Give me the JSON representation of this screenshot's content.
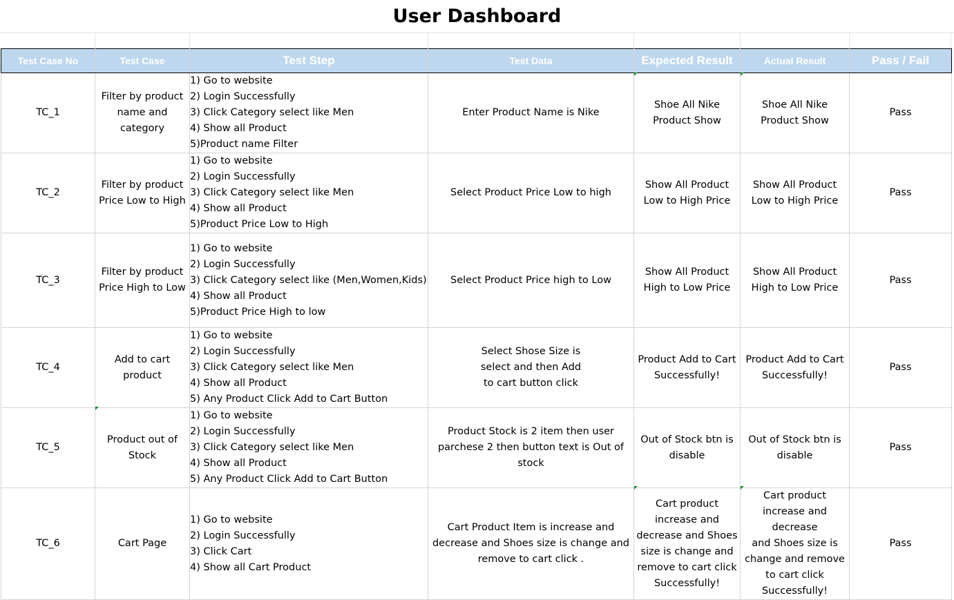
{
  "title": "User Dashboard",
  "columns": [
    "Test Case No",
    "Test Case",
    "Test Step",
    "Test Data",
    "Expected Result",
    "Actual Result",
    "Pass / Fail"
  ],
  "rows": [
    {
      "no": "TC_1",
      "case": "Filter by product\nname and\ncategory",
      "steps": [
        "1) Go to website",
        "2) Login Successfully",
        "3) Click Category select like Men",
        "4) Show all Product",
        "5)Product name Filter"
      ],
      "data": "Enter Product Name is Nike",
      "expected": "Shoe All Nike\nProduct Show",
      "actual": "Shoe All Nike\nProduct Show",
      "result": "Pass"
    },
    {
      "no": "TC_2",
      "case": "Filter by product\nPrice Low to High",
      "steps": [
        "1) Go to website",
        "2) Login Successfully",
        "3) Click Category select like Men",
        "4) Show all Product",
        "5)Product Price Low to High"
      ],
      "data": "Select Product Price Low to high",
      "expected": "Show All Product\nLow to High Price",
      "actual": "Show All Product\nLow to High Price",
      "result": "Pass"
    },
    {
      "no": "TC_3",
      "case": "Filter by product\nPrice High to Low",
      "steps": [
        "1) Go to website",
        "2) Login Successfully",
        "3) Click Category select like (Men,Women,Kids)",
        "4) Show all Product",
        "5)Product Price High to low"
      ],
      "data": "Select Product Price high to Low",
      "expected": "Show All Product\nHigh to Low Price",
      "actual": "Show All Product\nHigh to Low Price",
      "result": "Pass"
    },
    {
      "no": "TC_4",
      "case": "Add to cart\nproduct",
      "steps": [
        "1) Go to website",
        "2) Login Successfully",
        "3) Click Category select like Men",
        "4) Show all Product",
        "5) Any Product Click Add to Cart Button"
      ],
      "data": "Select Shose Size is\nselect and then Add\nto cart button click",
      "expected": "Product Add to Cart\nSuccessfully!",
      "actual": "Product Add to Cart\nSuccessfully!",
      "result": "Pass"
    },
    {
      "no": "TC_5",
      "case": "Product out of\nStock",
      "steps": [
        "1) Go to website",
        "2) Login Successfully",
        "3) Click Category select like Men",
        "4) Show all Product",
        "5) Any Product Click Add to Cart Button"
      ],
      "data": "Product Stock is 2 item then user\nparchese 2 then button text is Out of\nstock",
      "expected": "Out of Stock btn  is\ndisable",
      "actual": "Out of Stock btn  is\ndisable",
      "result": "Pass"
    },
    {
      "no": "TC_6",
      "case": "Cart Page",
      "steps": [
        "1) Go to website",
        "2) Login Successfully",
        "3) Click Cart",
        "4) Show all Cart Product"
      ],
      "data": "Cart Product Item is increase and\ndecrease and Shoes size is change and\nremove to cart click .",
      "expected": "Cart product\nincrease and\ndecrease and Shoes\nsize is change and\nremove to cart click\nSuccessfully!",
      "actual": "Cart product\nincrease and decrease\nand Shoes size is\nchange and remove\nto cart click\nSuccessfully!",
      "result": "Pass"
    }
  ]
}
